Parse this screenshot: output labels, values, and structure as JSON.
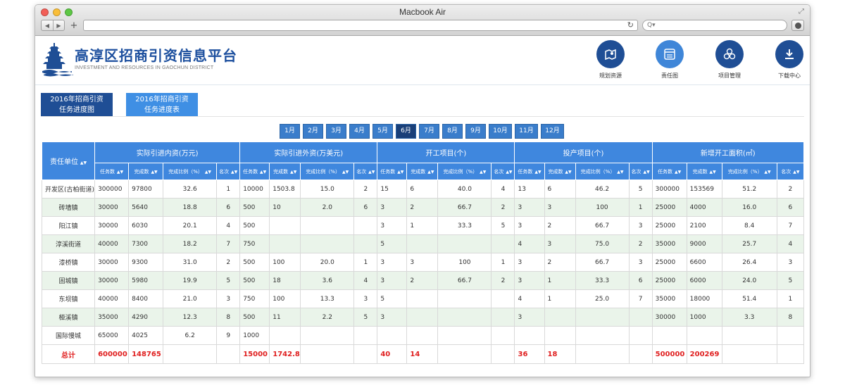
{
  "window": {
    "title": "Macbook Air"
  },
  "browser": {
    "search_placeholder": "Q▾"
  },
  "site": {
    "title": "高淳区招商引资信息平台",
    "subtitle": "INVESTMENT AND RESOURCES IN GAOCHUN DISTRICT",
    "logo_text": "高淳"
  },
  "nav": [
    {
      "label": "规划资源",
      "icon": "map-icon"
    },
    {
      "label": "责任图",
      "icon": "window-icon"
    },
    {
      "label": "项目管理",
      "icon": "hexagon-icon"
    },
    {
      "label": "下载中心",
      "icon": "download-icon"
    }
  ],
  "tabs": [
    {
      "line1": "2016年招商引资",
      "line2": "任务进度图"
    },
    {
      "line1": "2016年招商引资",
      "line2": "任务进度表"
    }
  ],
  "months": [
    "1月",
    "2月",
    "3月",
    "4月",
    "5月",
    "6月",
    "7月",
    "8月",
    "9月",
    "10月",
    "11月",
    "12月"
  ],
  "selected_month": "6月",
  "table": {
    "unit_header": "责任单位",
    "groups": [
      "实际引进内资(万元)",
      "实际引进外资(万美元)",
      "开工项目(个)",
      "投产项目(个)",
      "新增开工面积(㎡)"
    ],
    "subheaders": [
      "任务数",
      "完成数",
      "完成比例（%）",
      "名次"
    ],
    "rows": [
      [
        "开发区(古柏街道)",
        "300000",
        "97800",
        "32.6",
        "1",
        "10000",
        "1503.8",
        "15.0",
        "2",
        "15",
        "6",
        "40.0",
        "4",
        "13",
        "6",
        "46.2",
        "5",
        "300000",
        "153569",
        "51.2",
        "2"
      ],
      [
        "砖墙镇",
        "30000",
        "5640",
        "18.8",
        "6",
        "500",
        "10",
        "2.0",
        "6",
        "3",
        "2",
        "66.7",
        "2",
        "3",
        "3",
        "100",
        "1",
        "25000",
        "4000",
        "16.0",
        "6"
      ],
      [
        "阳江镇",
        "30000",
        "6030",
        "20.1",
        "4",
        "500",
        "",
        "",
        "",
        "3",
        "1",
        "33.3",
        "5",
        "3",
        "2",
        "66.7",
        "3",
        "25000",
        "2100",
        "8.4",
        "7"
      ],
      [
        "淳溪街道",
        "40000",
        "7300",
        "18.2",
        "7",
        "750",
        "",
        "",
        "",
        "5",
        "",
        "",
        "",
        "4",
        "3",
        "75.0",
        "2",
        "35000",
        "9000",
        "25.7",
        "4"
      ],
      [
        "漆桥镇",
        "30000",
        "9300",
        "31.0",
        "2",
        "500",
        "100",
        "20.0",
        "1",
        "3",
        "3",
        "100",
        "1",
        "3",
        "2",
        "66.7",
        "3",
        "25000",
        "6600",
        "26.4",
        "3"
      ],
      [
        "固城镇",
        "30000",
        "5980",
        "19.9",
        "5",
        "500",
        "18",
        "3.6",
        "4",
        "3",
        "2",
        "66.7",
        "2",
        "3",
        "1",
        "33.3",
        "6",
        "25000",
        "6000",
        "24.0",
        "5"
      ],
      [
        "东坝镇",
        "40000",
        "8400",
        "21.0",
        "3",
        "750",
        "100",
        "13.3",
        "3",
        "5",
        "",
        "",
        "",
        "4",
        "1",
        "25.0",
        "7",
        "35000",
        "18000",
        "51.4",
        "1"
      ],
      [
        "桠溪镇",
        "35000",
        "4290",
        "12.3",
        "8",
        "500",
        "11",
        "2.2",
        "5",
        "3",
        "",
        "",
        "",
        "3",
        "",
        "",
        "",
        "30000",
        "1000",
        "3.3",
        "8"
      ],
      [
        "国际慢城",
        "65000",
        "4025",
        "6.2",
        "9",
        "1000",
        "",
        "",
        "",
        "",
        "",
        "",
        "",
        "",
        "",
        "",
        "",
        "",
        "",
        "",
        ""
      ]
    ],
    "total": [
      "总计",
      "600000",
      "148765",
      "",
      "",
      "15000",
      "1742.8",
      "",
      "",
      "40",
      "14",
      "",
      "",
      "36",
      "18",
      "",
      "",
      "500000",
      "200269",
      "",
      ""
    ]
  },
  "colors": {
    "primary": "#1f4e95",
    "header_blue": "#3f87de",
    "total_red": "#e02020",
    "alt_row": "#eaf4ea"
  }
}
